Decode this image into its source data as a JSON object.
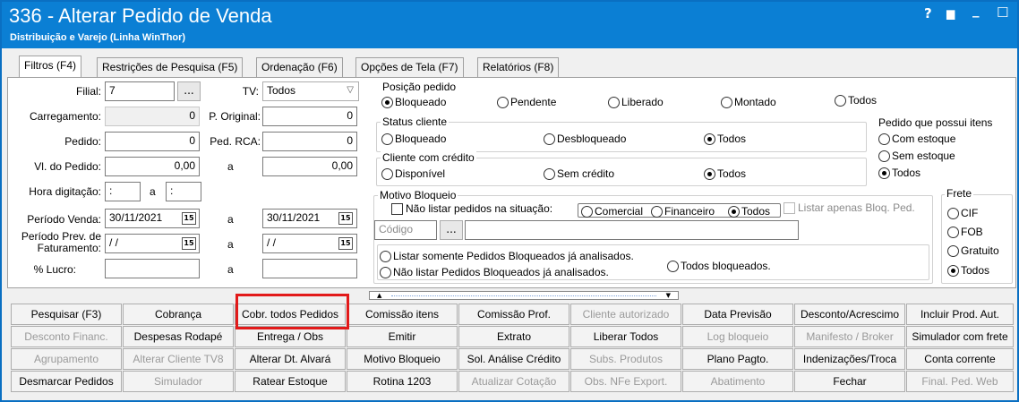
{
  "window": {
    "title": "336 - Alterar Pedido de Venda",
    "subtitle": "Distribuição e Varejo (Linha WinThor)",
    "help": "?",
    "restore": "▆",
    "minimize": "_",
    "maximize": "☐"
  },
  "tabs": [
    "Filtros (F4)",
    "Restrições de Pesquisa (F5)",
    "Ordenação (F6)",
    "Opções de Tela (F7)",
    "Relatórios (F8)"
  ],
  "filters": {
    "filial_label": "Filial:",
    "filial_value": "7",
    "lookup": "...",
    "tv_label": "TV:",
    "tv_value": "Todos",
    "carregamento_label": "Carregamento:",
    "carregamento_value": "0",
    "p_original_label": "P. Original:",
    "p_original_value": "0",
    "pedido_label": "Pedido:",
    "pedido_value": "0",
    "ped_rca_label": "Ped. RCA:",
    "ped_rca_value": "0",
    "vl_pedido_label": "Vl. do Pedido:",
    "vl_pedido_from": "0,00",
    "a": "a",
    "vl_pedido_to": "0,00",
    "hora_label": "Hora digitação:",
    "hora_from": ":",
    "hora_to": ":",
    "periodo_venda_label": "Período Venda:",
    "periodo_venda_from": "30/11/2021",
    "periodo_venda_to": "30/11/2021",
    "periodo_prev_label_1": "Período Prev. de",
    "periodo_prev_label_2": "Faturamento:",
    "periodo_prev_from": "/ /",
    "periodo_prev_to": "/ /",
    "lucro_label": "% Lucro:",
    "cal_icon": "15"
  },
  "posicao": {
    "title": "Posição pedido",
    "options": [
      "Bloqueado",
      "Pendente",
      "Liberado",
      "Montado",
      "Todos"
    ],
    "selected": "Bloqueado"
  },
  "status_cliente": {
    "title": "Status cliente",
    "options": [
      "Bloqueado",
      "Desbloqueado",
      "Todos"
    ],
    "selected": "Todos"
  },
  "credito": {
    "title": "Cliente com crédito",
    "options": [
      "Disponível",
      "Sem crédito",
      "Todos"
    ],
    "selected": "Todos"
  },
  "itens": {
    "title": "Pedido que possui itens",
    "options": [
      "Com estoque",
      "Sem estoque",
      "Todos"
    ],
    "selected": "Todos"
  },
  "motivo": {
    "title": "Motivo Bloqueio",
    "nao_listar": "Não listar pedidos na situação:",
    "options": [
      "Comercial",
      "Financeiro",
      "Todos"
    ],
    "selected": "Todos",
    "listar_apenas": "Listar apenas Bloq. Ped.",
    "codigo_placeholder": "Código",
    "analise_options": [
      "Listar somente Pedidos Bloqueados já analisados.",
      "Não listar Pedidos Bloqueados já analisados.",
      "Todos bloqueados."
    ]
  },
  "frete": {
    "title": "Frete",
    "options": [
      "CIF",
      "FOB",
      "Gratuito",
      "Todos"
    ],
    "selected": "Todos"
  },
  "buttons": [
    [
      "Pesquisar (F3)",
      "Cobrança",
      "Cobr. todos Pedidos",
      "Comissão itens",
      "Comissão Prof.",
      "Cliente autorizado",
      "Data Previsão",
      "Desconto/Acrescimo",
      "Incluir Prod. Aut."
    ],
    [
      "Desconto Financ.",
      "Despesas Rodapé",
      "Entrega / Obs",
      "Emitir",
      "Extrato",
      "Liberar Todos",
      "Log bloqueio",
      "Manifesto / Broker",
      "Simulador com frete"
    ],
    [
      "Agrupamento",
      "Alterar Cliente TV8",
      "Alterar Dt. Alvará",
      "Motivo Bloqueio",
      "Sol. Análise Crédito",
      "Subs. Produtos",
      "Plano Pagto.",
      "Indenizações/Troca",
      "Conta corrente"
    ],
    [
      "Desmarcar Pedidos",
      "Simulador",
      "Ratear Estoque",
      "Rotina 1203",
      "Atualizar Cotação",
      "Obs. NFe Export.",
      "Abatimento",
      "Fechar",
      "Final. Ped. Web"
    ]
  ],
  "buttons_disabled": [
    [
      false,
      false,
      false,
      false,
      false,
      true,
      false,
      false,
      false
    ],
    [
      true,
      false,
      false,
      false,
      false,
      false,
      true,
      true,
      false
    ],
    [
      true,
      true,
      false,
      false,
      false,
      true,
      false,
      false,
      false
    ],
    [
      false,
      true,
      false,
      false,
      true,
      true,
      true,
      false,
      true
    ]
  ]
}
